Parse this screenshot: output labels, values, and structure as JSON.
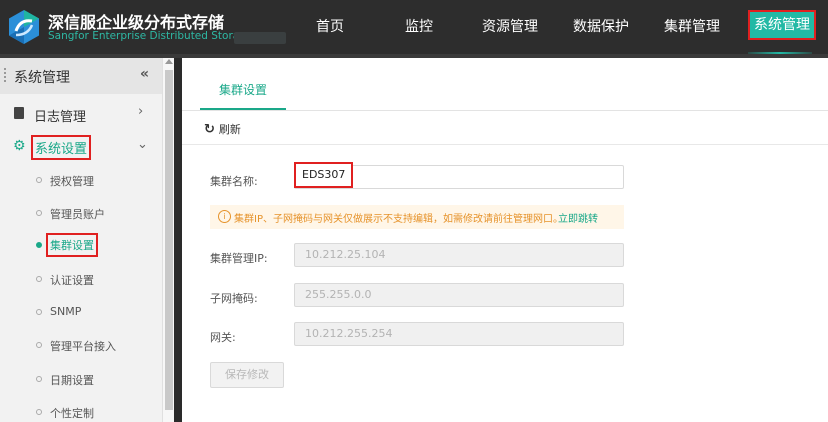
{
  "header": {
    "brand_cn": "深信服企业级分布式存储",
    "brand_en": "Sangfor Enterprise Distributed Storage",
    "nav": [
      "首页",
      "监控",
      "资源管理",
      "数据保护",
      "集群管理",
      "系统管理"
    ],
    "active_nav": "系统管理",
    "accent_color": "#22b9a5"
  },
  "sidebar": {
    "title": "系统管理",
    "collapse_icon": "«",
    "log_label": "日志管理",
    "settings_label": "系统设置",
    "sub_items": [
      "授权管理",
      "管理员账户",
      "集群设置",
      "认证设置",
      "SNMP",
      "管理平台接入",
      "日期设置",
      "个性定制"
    ],
    "active_sub": "集群设置"
  },
  "main": {
    "tab": "集群设置",
    "refresh": "刷新",
    "form": {
      "name_label": "集群名称:",
      "name_value": "EDS307",
      "notice": "集群IP、子网掩码与网关仅做展示不支持编辑，如需修改请前往管理网口。",
      "notice_link": "立即跳转",
      "ip_label": "集群管理IP:",
      "ip_value": "10.212.25.104",
      "mask_label": "子网掩码:",
      "mask_value": "255.255.0.0",
      "gateway_label": "网关:",
      "gateway_value": "10.212.255.254",
      "save_label": "保存修改"
    }
  }
}
